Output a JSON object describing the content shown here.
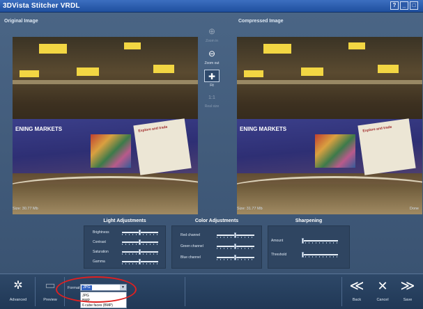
{
  "window": {
    "title": "3DVista Stitcher VRDL",
    "controls": {
      "help": "?",
      "minimize": "_",
      "restore": "□",
      "close": "×"
    }
  },
  "panels": {
    "original": {
      "title": "Original Image",
      "size_label": "Size: 30.77 Mb",
      "image_text": {
        "banner": "ENING MARKETS",
        "poster_title": "Explore and trade"
      }
    },
    "compressed": {
      "title": "Compressed Image",
      "size_label": "Size: 31.77 Mb",
      "status": "Done",
      "image_text": {
        "banner": "ENING MARKETS",
        "poster_title": "Explore and trade"
      }
    }
  },
  "zoom": {
    "zoom_in": {
      "label": "Zoom in",
      "icon": "zoom-in-icon",
      "glyph": "⊕"
    },
    "zoom_out": {
      "label": "Zoom out",
      "icon": "zoom-out-icon",
      "glyph": "⊖"
    },
    "fit": {
      "label": "Fit",
      "icon": "fit-icon",
      "glyph": "✚"
    },
    "real_size": {
      "label": "Real size",
      "icon": "real-size-icon",
      "glyph": "1:1"
    }
  },
  "adjustments": {
    "light": {
      "title": "Light Adjustments",
      "sliders": [
        {
          "label": "Brightness",
          "value": 0.5
        },
        {
          "label": "Contrast",
          "value": 0.5
        },
        {
          "label": "Saturation",
          "value": 0.5
        },
        {
          "label": "Gamma",
          "value": 0.5
        }
      ]
    },
    "color": {
      "title": "Color Adjustments",
      "sliders": [
        {
          "label": "Red channel",
          "value": 0.5
        },
        {
          "label": "Green channel",
          "value": 0.5
        },
        {
          "label": "Blue channel",
          "value": 0.5
        }
      ]
    },
    "sharpening": {
      "title": "Sharpening",
      "sliders": [
        {
          "label": "Amount",
          "value": 0.0
        },
        {
          "label": "Threshold",
          "value": 0.0
        }
      ]
    }
  },
  "toolbar": {
    "advanced": {
      "label": "Advanced",
      "icon": "gear-icon",
      "glyph": "✲"
    },
    "preview": {
      "label": "Preview",
      "icon": "preview-icon",
      "glyph": "▭"
    },
    "format": {
      "label": "Format",
      "selected": "JPG",
      "options": [
        "JPG",
        "BMP",
        "6 cube faces (BMP)"
      ]
    },
    "back": {
      "label": "Back",
      "icon": "double-chevron-left-icon",
      "glyph": "≪"
    },
    "cancel": {
      "label": "Cancel",
      "icon": "close-icon",
      "glyph": "✕"
    },
    "save": {
      "label": "Save",
      "icon": "double-chevron-right-icon",
      "glyph": "≫"
    }
  },
  "colors": {
    "background": "#3d5674",
    "titlebar": "#2a5bb0",
    "toolbar": "#233a58",
    "highlight": "#e02020",
    "select_highlight": "#3162c2"
  }
}
